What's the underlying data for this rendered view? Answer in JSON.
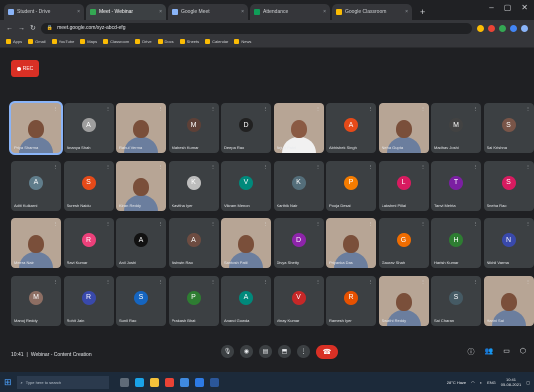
{
  "browser": {
    "tabs": [
      {
        "label": "Student - Drive",
        "color": "#8ab4f8"
      },
      {
        "label": "Meet - Webinar",
        "color": "#34a853",
        "active": true
      },
      {
        "label": "Google Meet",
        "color": "#8ab4f8"
      },
      {
        "label": "Attendance",
        "color": "#0f9d58"
      },
      {
        "label": "Google Classroom",
        "color": "#fbbc04"
      }
    ],
    "address": "meet.google.com/xyz-abcd-efg",
    "bookmarks": [
      "Apps",
      "Gmail",
      "YouTube",
      "Maps",
      "Classroom",
      "Drive",
      "Docs",
      "Sheets",
      "Calendar",
      "News"
    ]
  },
  "record_label": "REC",
  "participants": [
    {
      "name": "Priya Sharma",
      "video": true,
      "active": true,
      "color": "#1e88e5",
      "initial": "P"
    },
    {
      "name": "Ananya Shah",
      "video": false,
      "color": "#9e9e9e",
      "initial": "A"
    },
    {
      "name": "Rahul Verma",
      "video": true,
      "color": "#8d6e63",
      "initial": "R"
    },
    {
      "name": "Mahesh Kumar",
      "video": false,
      "color": "#5d4037",
      "initial": "M"
    },
    {
      "name": "Deepa Rao",
      "video": false,
      "color": "#212121",
      "initial": "D"
    },
    {
      "name": "Arjun Patel",
      "video": true,
      "color": "#ffffff",
      "initial": "A"
    },
    {
      "name": "Abhishek Singh",
      "video": false,
      "color": "#e64a19",
      "initial": "A"
    },
    {
      "name": "Neha Gupta",
      "video": true,
      "color": "#6d4c41",
      "initial": "N"
    },
    {
      "name": "Madhav Joshi",
      "video": false,
      "color": "#424242",
      "initial": "M"
    },
    {
      "name": "Sai Krishna",
      "video": false,
      "color": "#795548",
      "initial": "S"
    },
    {
      "name": "Aditi Kulkarni",
      "video": false,
      "color": "#607d8b",
      "initial": "A"
    },
    {
      "name": "Suresh Naidu",
      "video": false,
      "color": "#e64a19",
      "initial": "S"
    },
    {
      "name": "Kiran Reddy",
      "video": true,
      "color": "#6d4c41",
      "initial": "K"
    },
    {
      "name": "Kavitha Iyer",
      "video": false,
      "color": "#bdbdbd",
      "initial": "K"
    },
    {
      "name": "Vikram Menon",
      "video": false,
      "color": "#00897b",
      "initial": "V"
    },
    {
      "name": "Karthik Nair",
      "video": false,
      "color": "#546e7a",
      "initial": "K"
    },
    {
      "name": "Pooja Desai",
      "video": false,
      "color": "#f57c00",
      "initial": "P"
    },
    {
      "name": "Lakshmi Pillai",
      "video": false,
      "color": "#d81b60",
      "initial": "L"
    },
    {
      "name": "Tanvi Mehta",
      "video": false,
      "color": "#7b1fa2",
      "initial": "T"
    },
    {
      "name": "Sneha Rao",
      "video": false,
      "color": "#d81b60",
      "initial": "S"
    },
    {
      "name": "Meera Nair",
      "video": true,
      "color": "#bcaaa4",
      "initial": "M"
    },
    {
      "name": "Ravi Kumar",
      "video": false,
      "color": "#ec407a",
      "initial": "R"
    },
    {
      "name": "Anil Joshi",
      "video": false,
      "color": "#111111",
      "initial": "A"
    },
    {
      "name": "Ashwin Rao",
      "video": false,
      "color": "#6d4c41",
      "initial": "A"
    },
    {
      "name": "Santosh Patil",
      "video": true,
      "color": "#8d6e63",
      "initial": "S"
    },
    {
      "name": "Divya Shetty",
      "video": false,
      "color": "#8e24aa",
      "initial": "D"
    },
    {
      "name": "Priyanka Das",
      "video": true,
      "color": "#ec407a",
      "initial": "P"
    },
    {
      "name": "Gaurav Shah",
      "video": false,
      "color": "#ef6c00",
      "initial": "G"
    },
    {
      "name": "Harish Kumar",
      "video": false,
      "color": "#2e7d32",
      "initial": "H"
    },
    {
      "name": "Nikhil Varma",
      "video": false,
      "color": "#3949ab",
      "initial": "N"
    },
    {
      "name": "Manoj Reddy",
      "video": false,
      "color": "#8d6e63",
      "initial": "M"
    },
    {
      "name": "Rohit Jain",
      "video": false,
      "color": "#3949ab",
      "initial": "R"
    },
    {
      "name": "Sunil Rao",
      "video": false,
      "color": "#1565c0",
      "initial": "S"
    },
    {
      "name": "Prakash Bhat",
      "video": false,
      "color": "#2e7d32",
      "initial": "P"
    },
    {
      "name": "Anand Gowda",
      "video": false,
      "color": "#00897b",
      "initial": "A"
    },
    {
      "name": "Vinay Kumar",
      "video": false,
      "color": "#c62828",
      "initial": "V"
    },
    {
      "name": "Ramesh Iyer",
      "video": false,
      "color": "#e65100",
      "initial": "R"
    },
    {
      "name": "Swathi Reddy",
      "video": true,
      "color": "#d7ccc8",
      "initial": "S"
    },
    {
      "name": "Sai Charan",
      "video": false,
      "color": "#455a64",
      "initial": "S"
    },
    {
      "name": "Harini Sai",
      "video": true,
      "color": "#a1887f",
      "initial": "H"
    }
  ],
  "meeting": {
    "time": "10:41",
    "separator": "|",
    "title": "Webinar - Content Creation"
  },
  "controls": [
    "mic",
    "camera",
    "captions",
    "present",
    "more"
  ],
  "taskbar": {
    "search_placeholder": "Type here to search",
    "weather": "28°C Haze",
    "language": "ENG",
    "time": "10:41",
    "date": "05-08-2021"
  }
}
